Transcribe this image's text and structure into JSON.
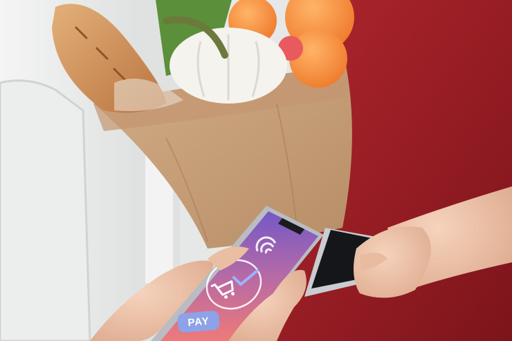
{
  "scene": {
    "description_items": [
      "door",
      "grocery-bag",
      "baguette",
      "pumpkin",
      "oranges",
      "delivery-person",
      "smartphone-customer",
      "smartphone-courier"
    ],
    "colors": {
      "shirt": "#9c1c24",
      "bag": "#c69e78",
      "phone_screen_top": "#7b5cc7",
      "phone_screen_bottom": "#e7727a",
      "pay_button": "#8ea2e8"
    }
  },
  "phone_screen": {
    "pay_label": "PAY",
    "icons": [
      "wifi-icon",
      "checkmark-icon",
      "shopping-cart-icon"
    ]
  }
}
